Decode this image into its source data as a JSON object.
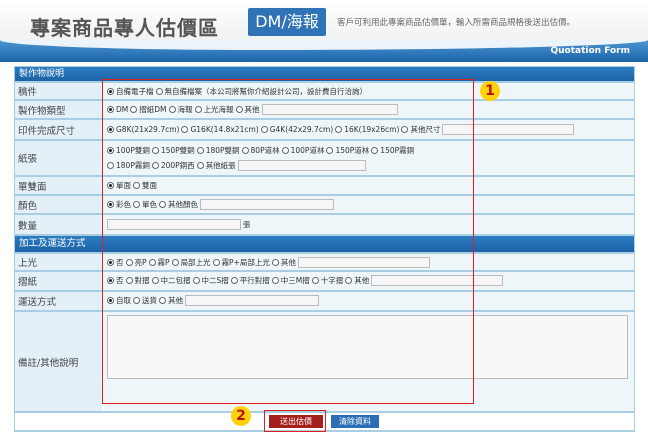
{
  "header": {
    "title": "專案商品專人估價區",
    "badge": "DM/海報",
    "description": "客戶可利用此專案商品估價單，輸入所需商品規格後送出估價。",
    "banner_text": "Quotation Form"
  },
  "sections": {
    "production": "製作物說明",
    "processing": "加工及運送方式"
  },
  "rows": {
    "manuscript": {
      "label": "稿件",
      "options": [
        "自備電子檔",
        "無自備檔案（本公司將幫你介紹設計公司，設計費自行洽詢）"
      ]
    },
    "type": {
      "label": "製作物類型",
      "options": [
        "DM",
        "摺紙DM",
        "海報",
        "上光海報",
        "其他"
      ]
    },
    "size": {
      "label": "印件完成尺寸",
      "options": [
        "G8K(21x29.7cm)",
        "G16K(14.8x21cm)",
        "G4K(42x29.7cm)",
        "16K(19x26cm)",
        "其他尺寸"
      ]
    },
    "paper": {
      "label": "紙張",
      "options_line1": [
        "100P雙銅",
        "150P雙銅",
        "180P雙銅",
        "80P道林",
        "100P道林",
        "150P道林",
        "150P霧銅"
      ],
      "options_line2": [
        "180P霧銅",
        "200P銅西",
        "其他紙張"
      ]
    },
    "sides": {
      "label": "單雙面",
      "options": [
        "單面",
        "雙面"
      ]
    },
    "color": {
      "label": "顏色",
      "options": [
        "彩色",
        "單色",
        "其他顏色"
      ]
    },
    "quantity": {
      "label": "數量",
      "unit": "張",
      "value": ""
    },
    "gloss": {
      "label": "上光",
      "options": [
        "否",
        "亮P",
        "霧P",
        "局部上光",
        "霧P+局部上光",
        "其他"
      ]
    },
    "fold": {
      "label": "摺紙",
      "options": [
        "否",
        "對摺",
        "中二包摺",
        "中二S摺",
        "平行對摺",
        "中三M摺",
        "十字摺",
        "其他"
      ]
    },
    "delivery": {
      "label": "運送方式",
      "options": [
        "自取",
        "送貨",
        "其他"
      ]
    },
    "remarks": {
      "label": "備註/其他說明",
      "value": ""
    }
  },
  "buttons": {
    "submit": "送出估價",
    "clear": "清除資料"
  },
  "callouts": {
    "one": "1",
    "two": "2"
  },
  "colors": {
    "accent": "#2f73b6",
    "label_bg": "#e3f0f7",
    "highlight": "#e02020",
    "callout": "#ffd20a"
  }
}
